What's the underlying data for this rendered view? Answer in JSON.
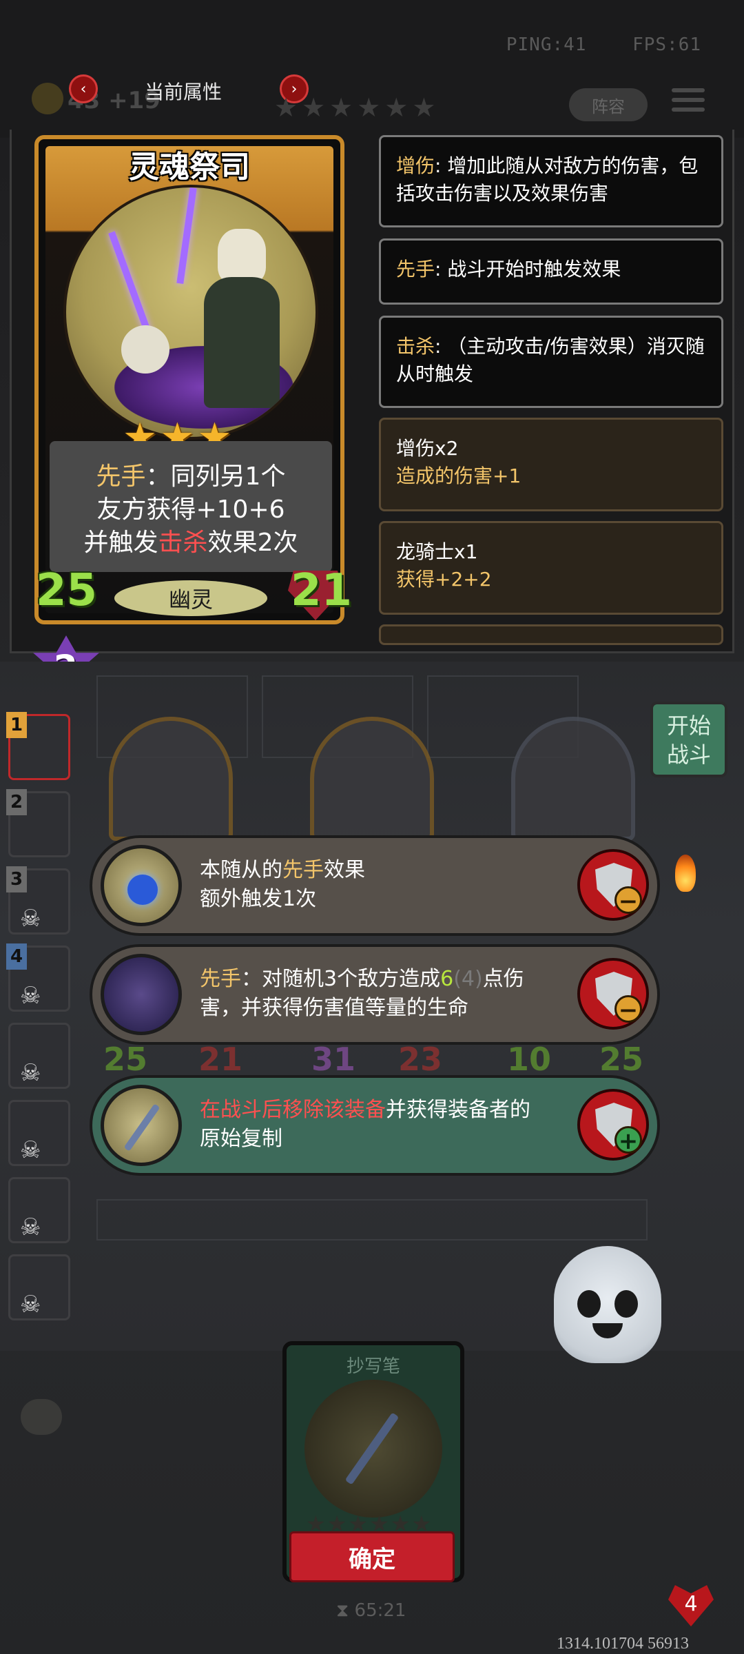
{
  "hud": {
    "ping": "PING:41",
    "fps": "FPS:61",
    "gold": "43 +19",
    "lineup_label": "阵容"
  },
  "tier_nav": {
    "prev_icon": "chevron-left-icon",
    "next_icon": "chevron-right-icon",
    "title": "当前属性",
    "stars": "★★★★★★"
  },
  "card": {
    "name": "灵魂祭司",
    "stars": "★★★",
    "desc_line1_kw": "先手",
    "desc_line1_rest": "：同列另1个",
    "desc_line2": "友方获得+10+6",
    "desc_line3_pre": "并触发",
    "desc_line3_kw": "击杀",
    "desc_line3_post": "效果2次",
    "attack": "25",
    "health": "21",
    "tribe": "幽灵",
    "tier": "2"
  },
  "keywords": [
    {
      "kw": "增伤",
      "text": ": 增加此随从对敌方的伤害，包括攻击伤害以及效果伤害"
    },
    {
      "kw": "先手",
      "text": ": 战斗开始时触发效果"
    },
    {
      "kw": "击杀",
      "text": ": （主动攻击/伤害效果）消灭随从时触发"
    }
  ],
  "buffs": [
    {
      "title": "增伤x2",
      "detail": "造成的伤害+1"
    },
    {
      "title": "龙骑士x1",
      "detail": "获得+2+2"
    }
  ],
  "roster": [
    "1",
    "2",
    "3",
    "4"
  ],
  "start_battle": {
    "line1": "开始",
    "line2": "战斗"
  },
  "board_stats": [
    "25",
    "21",
    "31",
    "23",
    "10",
    "25"
  ],
  "options": [
    {
      "pre": "本随从的",
      "kw": "先手",
      "post": "效果",
      "line2": "额外触发1次",
      "action": "−"
    },
    {
      "kw": "先手",
      "mid": "：对随机3个敌方造成",
      "num": "6",
      "dim": "(4)",
      "post": "点伤",
      "line2": "害，并获得伤害值等量的生命",
      "action": "−"
    },
    {
      "red": "在战斗后移除该装备",
      "post": "并获得装备者的",
      "line2": "原始复制",
      "action": "+"
    }
  ],
  "item": {
    "name": "抄写笔",
    "stars": "★★★★★★",
    "confirm": "确定"
  },
  "timer": "65:21",
  "lives": "4",
  "coords": "1314.101704 56913",
  "colors": {
    "keyword_yellow": "#f3c56a",
    "keyword_red": "#ff5050",
    "value_green": "#b7e63d",
    "card_border_gold": "#c98a2a",
    "confirm_red": "#c41f2a",
    "start_green": "#3e7a5e"
  }
}
